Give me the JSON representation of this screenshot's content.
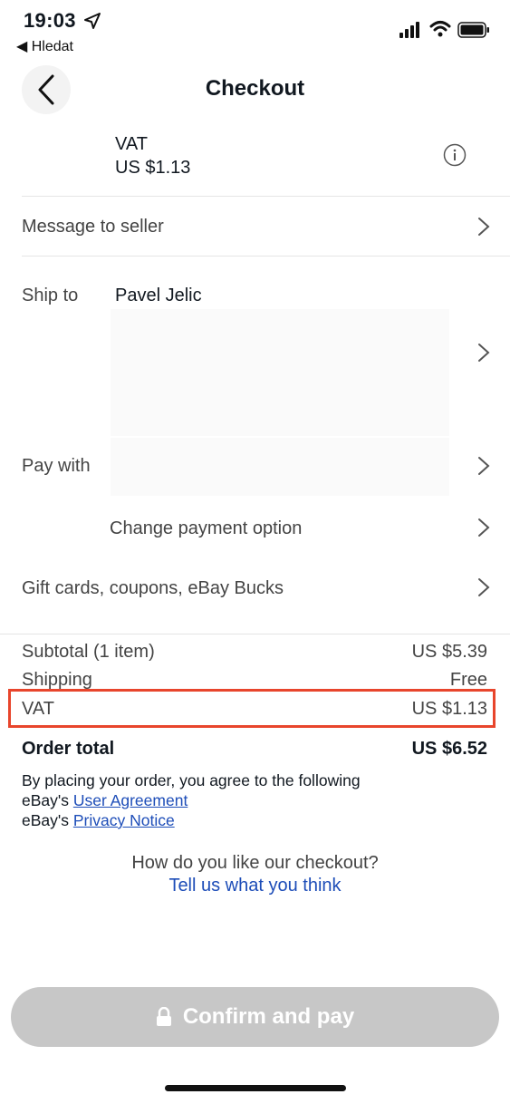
{
  "status_bar": {
    "time": "19:03",
    "back_app": "◀ Hledat"
  },
  "header": {
    "title": "Checkout"
  },
  "vat_row": {
    "label": "VAT",
    "value": "US $1.13"
  },
  "rows": {
    "message_to_seller": "Message to seller",
    "ship_to_label": "Ship to",
    "ship_to_name": "Pavel Jelic",
    "pay_with_label": "Pay with",
    "change_payment": "Change payment option",
    "gift_cards": "Gift cards, coupons, eBay Bucks"
  },
  "summary": {
    "subtotal_label": "Subtotal (1 item)",
    "subtotal_value": "US $5.39",
    "shipping_label": "Shipping",
    "shipping_value": "Free",
    "vat_label": "VAT",
    "vat_value": "US $1.13",
    "total_label": "Order total",
    "total_value": "US $6.52"
  },
  "legal": {
    "line1": "By placing your order, you agree to the following",
    "prefix": "eBay's",
    "user_agreement": "User Agreement",
    "privacy_notice": "Privacy Notice"
  },
  "feedback": {
    "question": "How do you like our checkout?",
    "link": "Tell us what you think"
  },
  "confirm_button": {
    "label": "Confirm and pay"
  },
  "colors": {
    "link": "#1d4db8",
    "highlight": "#e8452c",
    "disabled_button": "#c7c7c7"
  },
  "icons": [
    "location-arrow-icon",
    "signal-icon",
    "wifi-icon",
    "battery-icon",
    "back-arrow-icon",
    "info-icon",
    "chevron-right-icon",
    "lock-icon"
  ]
}
